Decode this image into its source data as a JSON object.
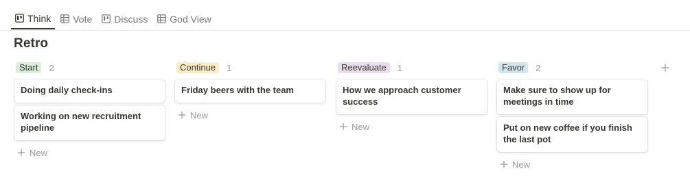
{
  "tabs": [
    {
      "label": "Think",
      "icon": "board-icon",
      "active": true
    },
    {
      "label": "Vote",
      "icon": "table-icon",
      "active": false
    },
    {
      "label": "Discuss",
      "icon": "board-icon",
      "active": false
    },
    {
      "label": "God View",
      "icon": "table-icon",
      "active": false
    }
  ],
  "page": {
    "title": "Retro"
  },
  "colors": {
    "start_tag": "#dbeddb",
    "continue_tag": "#fdecc8",
    "reevaluate_tag": "#e8deee",
    "favor_tag": "#d3e5ef",
    "text": "#37352f",
    "muted": "#9b9a97"
  },
  "columns": [
    {
      "tag": "Start",
      "count": "2",
      "cards": [
        "Doing daily check-ins",
        "Working on new recruitment pipeline"
      ],
      "new_label": "New"
    },
    {
      "tag": "Continue",
      "count": "1",
      "cards": [
        "Friday beers with the team"
      ],
      "new_label": "New"
    },
    {
      "tag": "Reevaluate",
      "count": "1",
      "cards": [
        "How we approach customer success"
      ],
      "new_label": "New"
    },
    {
      "tag": "Favor",
      "count": "2",
      "cards": [
        "Make sure to show up for meetings in time",
        "Put on new coffee if you finish the last pot"
      ],
      "new_label": "New"
    }
  ],
  "add_group_icon": "plus-icon"
}
